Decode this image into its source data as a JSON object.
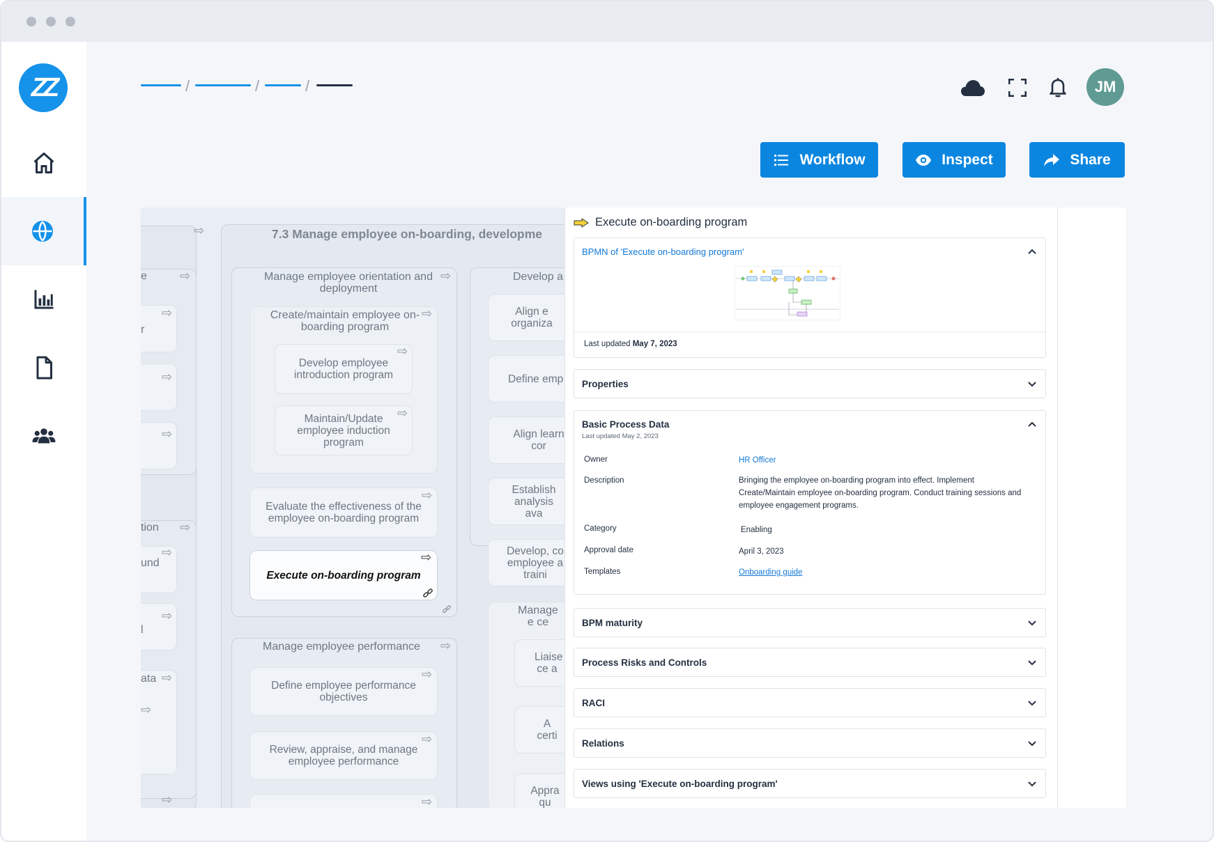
{
  "header": {
    "avatar_initials": "JM",
    "breadcrumbs": [
      {
        "color": "#1592ea"
      },
      {
        "color": "#1592ea"
      },
      {
        "color": "#1592ea"
      },
      {
        "color": "#243041"
      }
    ]
  },
  "toolbar": {
    "workflow_label": "Workflow",
    "inspect_label": "Inspect",
    "share_label": "Share"
  },
  "sidebar": {
    "items": [
      {
        "icon": "home-icon"
      },
      {
        "icon": "globe-icon",
        "active": true
      },
      {
        "icon": "bar-chart-icon"
      },
      {
        "icon": "document-icon"
      },
      {
        "icon": "users-icon"
      }
    ]
  },
  "diagram": {
    "group_title": "7.3 Manage employee on-boarding, developme",
    "left_col": {
      "header_1": "e",
      "row_1": "r",
      "header_2": "tion",
      "row_2": "und",
      "row_3": "l",
      "row_4": "ata"
    },
    "mid": {
      "orientation": "Manage employee orientation and deployment",
      "create_maintain": "Create/maintain employee on-boarding program",
      "develop_intro": "Develop employee introduction program",
      "maintain_update": "Maintain/Update employee induction program",
      "evaluate": "Evaluate the effectiveness of the employee on-boarding program",
      "execute": "Execute on-boarding program",
      "performance": "Manage employee performance",
      "define_objectives": "Define employee performance objectives",
      "review": "Review, appraise, and manage employee performance"
    },
    "right_col": {
      "develop": "Develop a",
      "align": "Align e organiza",
      "define": "Define emp",
      "align_learn": "Align learn cor",
      "establish": "Establish analysis ava",
      "develop_co": "Develop, co employee a traini",
      "manage": "Manage e ce",
      "liaise": "Liaise ce a",
      "a_certi": "A certi",
      "appra": "Appra qu"
    }
  },
  "panel": {
    "title": "Execute on-boarding program",
    "bpmn": {
      "title": "BPMN of 'Execute on-boarding program'",
      "last_updated_label": "Last updated",
      "last_updated_value": "May 7, 2023"
    },
    "properties_label": "Properties",
    "basic": {
      "title": "Basic Process Data",
      "subtitle": "Last updated May 2, 2023",
      "owner_label": "Owner",
      "owner_value": "HR Officer",
      "description_label": "Description",
      "description_value": "Bringing the employee on-boarding program into effect. Implement Create/Maintain employee on-boarding program. Conduct training sessions and employee engagement programs.",
      "category_label": "Category",
      "category_value": "Enabling",
      "approval_label": "Approval date",
      "approval_value": "April 3, 2023",
      "templates_label": "Templates",
      "templates_value": "Onboarding guide"
    },
    "sections": [
      {
        "label": "BPM maturity"
      },
      {
        "label": "Process Risks and Controls"
      },
      {
        "label": "RACI"
      },
      {
        "label": "Relations"
      },
      {
        "label": "Views using 'Execute on-boarding program'"
      }
    ]
  },
  "colors": {
    "accent": "#0b86e0",
    "brand": "#1592ea",
    "avatar": "#5f9a93",
    "text_dark": "#243041"
  }
}
